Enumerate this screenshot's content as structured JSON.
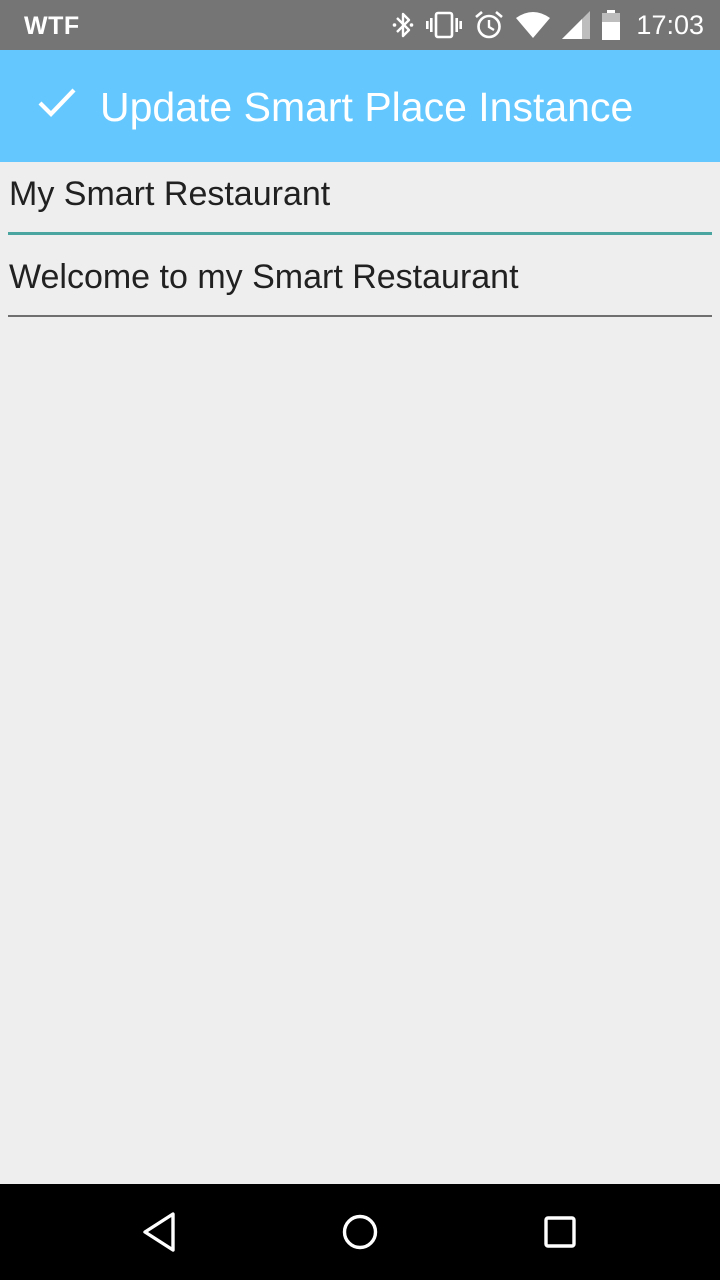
{
  "status_bar": {
    "carrier": "WTF",
    "time": "17:03",
    "icons": [
      "bluetooth-icon",
      "vibrate-icon",
      "alarm-icon",
      "wifi-icon",
      "cell-signal-icon",
      "battery-icon"
    ]
  },
  "app_bar": {
    "title": "Update Smart Place Instance",
    "action_icon": "check-icon",
    "background_color": "#64C8FE"
  },
  "form": {
    "name_value": "My Smart Restaurant",
    "description_value": "Welcome to my Smart Restaurant",
    "focused_underline_color": "#4AA5A0"
  },
  "nav_bar": {
    "icons": [
      "back-icon",
      "home-icon",
      "recents-icon"
    ]
  }
}
